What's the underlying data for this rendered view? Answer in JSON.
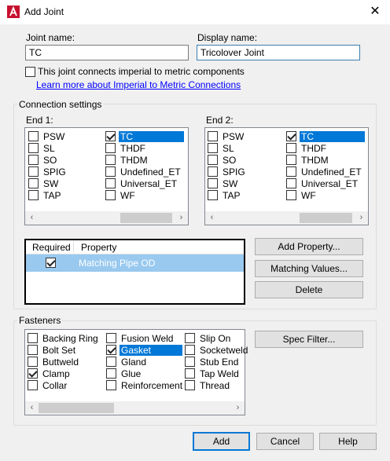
{
  "window": {
    "title": "Add Joint",
    "close_glyph": "✕"
  },
  "joint_name": {
    "label": "Joint name:",
    "value": "TC"
  },
  "display_name": {
    "label": "Display name:",
    "value": "Tricolover Joint"
  },
  "imperial_metric": {
    "label": "This joint connects imperial to metric components",
    "checked": false,
    "link": "Learn more about Imperial to Metric Connections"
  },
  "connection": {
    "title": "Connection settings",
    "end1": {
      "label": "End 1:",
      "col1": [
        {
          "label": "PSW",
          "checked": false
        },
        {
          "label": "SL",
          "checked": false
        },
        {
          "label": "SO",
          "checked": false
        },
        {
          "label": "SPIG",
          "checked": false
        },
        {
          "label": "SW",
          "checked": false
        },
        {
          "label": "TAP",
          "checked": false
        }
      ],
      "col2": [
        {
          "label": "TC",
          "checked": true,
          "selected": true
        },
        {
          "label": "THDF",
          "checked": false
        },
        {
          "label": "THDM",
          "checked": false
        },
        {
          "label": "Undefined_ET",
          "checked": false
        },
        {
          "label": "Universal_ET",
          "checked": false
        },
        {
          "label": "WF",
          "checked": false
        }
      ]
    },
    "end2": {
      "label": "End 2:",
      "col1": [
        {
          "label": "PSW",
          "checked": false
        },
        {
          "label": "SL",
          "checked": false
        },
        {
          "label": "SO",
          "checked": false
        },
        {
          "label": "SPIG",
          "checked": false
        },
        {
          "label": "SW",
          "checked": false
        },
        {
          "label": "TAP",
          "checked": false
        }
      ],
      "col2": [
        {
          "label": "TC",
          "checked": true,
          "selected": true
        },
        {
          "label": "THDF",
          "checked": false
        },
        {
          "label": "THDM",
          "checked": false
        },
        {
          "label": "Undefined_ET",
          "checked": false
        },
        {
          "label": "Universal_ET",
          "checked": false
        },
        {
          "label": "WF",
          "checked": false
        }
      ]
    },
    "grid": {
      "headers": [
        "Required",
        "Property"
      ],
      "rows": [
        {
          "required": true,
          "property": "Matching Pipe OD"
        }
      ]
    },
    "buttons": {
      "add_property": "Add Property...",
      "matching_values": "Matching Values...",
      "delete": "Delete"
    }
  },
  "fasteners": {
    "title": "Fasteners",
    "col1": [
      {
        "label": "Backing Ring",
        "checked": false
      },
      {
        "label": "Bolt Set",
        "checked": false
      },
      {
        "label": "Buttweld",
        "checked": false
      },
      {
        "label": "Clamp",
        "checked": true
      },
      {
        "label": "Collar",
        "checked": false
      }
    ],
    "col2": [
      {
        "label": "Fusion Weld",
        "checked": false
      },
      {
        "label": "Gasket",
        "checked": true,
        "selected": true
      },
      {
        "label": "Gland",
        "checked": false
      },
      {
        "label": "Glue",
        "checked": false
      },
      {
        "label": "Reinforcement R",
        "checked": false
      }
    ],
    "col3": [
      {
        "label": "Slip On",
        "checked": false
      },
      {
        "label": "Socketweld",
        "checked": false
      },
      {
        "label": "Stub End",
        "checked": false
      },
      {
        "label": "Tap Weld",
        "checked": false
      },
      {
        "label": "Thread",
        "checked": false
      }
    ],
    "spec_filter": "Spec Filter..."
  },
  "footer": {
    "add": "Add",
    "cancel": "Cancel",
    "help": "Help"
  },
  "scroll_glyphs": {
    "left": "‹",
    "right": "›"
  }
}
